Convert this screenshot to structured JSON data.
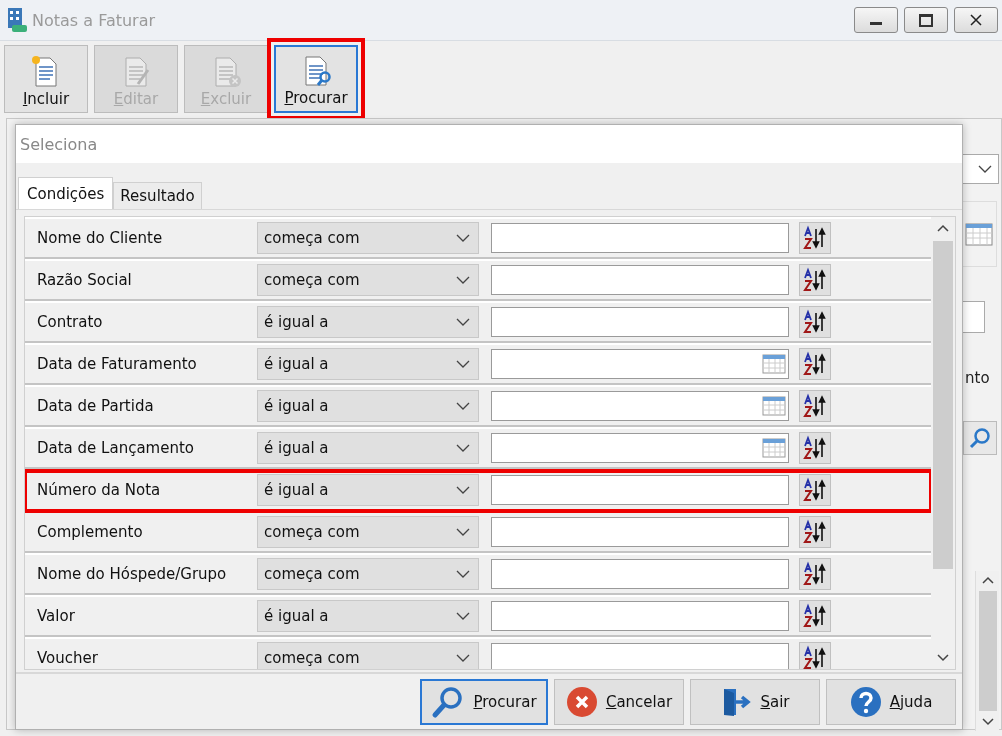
{
  "window": {
    "title": "Notas a Faturar"
  },
  "toolbar": [
    {
      "label": "Incluir",
      "disabled": false,
      "focused": false,
      "highlighted": false,
      "kind": "new"
    },
    {
      "label": "Editar",
      "disabled": true,
      "focused": false,
      "highlighted": false,
      "kind": "edit"
    },
    {
      "label": "Excluir",
      "disabled": true,
      "focused": false,
      "highlighted": false,
      "kind": "delete"
    },
    {
      "label": "Procurar",
      "disabled": false,
      "focused": true,
      "highlighted": true,
      "kind": "search"
    }
  ],
  "background": {
    "partial_label": "nto"
  },
  "dialog": {
    "title": "Seleciona",
    "tabs": [
      {
        "label": "Condições",
        "selected": true
      },
      {
        "label": "Resultado",
        "selected": false
      }
    ],
    "conditions": [
      {
        "field": "Nome do Cliente",
        "operator": "começa com",
        "kind": "text",
        "highlighted": false
      },
      {
        "field": "Razão Social",
        "operator": "começa com",
        "kind": "text",
        "highlighted": false
      },
      {
        "field": "Contrato",
        "operator": "é igual a",
        "kind": "text",
        "highlighted": false
      },
      {
        "field": "Data de Faturamento",
        "operator": "é igual a",
        "kind": "date",
        "highlighted": false
      },
      {
        "field": "Data de Partida",
        "operator": "é igual a",
        "kind": "date",
        "highlighted": false
      },
      {
        "field": "Data de Lançamento",
        "operator": "é igual a",
        "kind": "date",
        "highlighted": false
      },
      {
        "field": "Número da Nota",
        "operator": "é igual a",
        "kind": "text",
        "highlighted": true
      },
      {
        "field": "Complemento",
        "operator": "começa com",
        "kind": "text",
        "highlighted": false
      },
      {
        "field": "Nome do Hóspede/Grupo",
        "operator": "começa com",
        "kind": "text",
        "highlighted": false
      },
      {
        "field": "Valor",
        "operator": "é igual a",
        "kind": "text",
        "highlighted": false
      },
      {
        "field": "Voucher",
        "operator": "começa com",
        "kind": "text",
        "highlighted": false
      }
    ],
    "buttons": [
      {
        "label": "Procurar",
        "kind": "search",
        "focused": true
      },
      {
        "label": "Cancelar",
        "kind": "cancel",
        "focused": false
      },
      {
        "label": "Sair",
        "kind": "exit",
        "focused": false
      },
      {
        "label": "Ajuda",
        "kind": "help",
        "focused": false
      }
    ]
  }
}
